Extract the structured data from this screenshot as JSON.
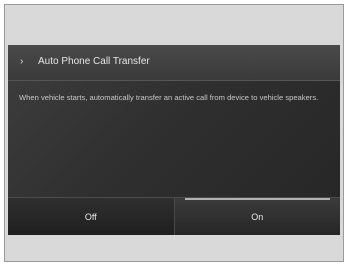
{
  "header": {
    "title": "Auto Phone Call Transfer",
    "chevron_icon": "chevron-right-icon"
  },
  "body": {
    "description": "When vehicle starts, automatically transfer an active call from device to vehicle speakers."
  },
  "options": [
    {
      "label": "Off",
      "selected": false
    },
    {
      "label": "On",
      "selected": true
    }
  ]
}
